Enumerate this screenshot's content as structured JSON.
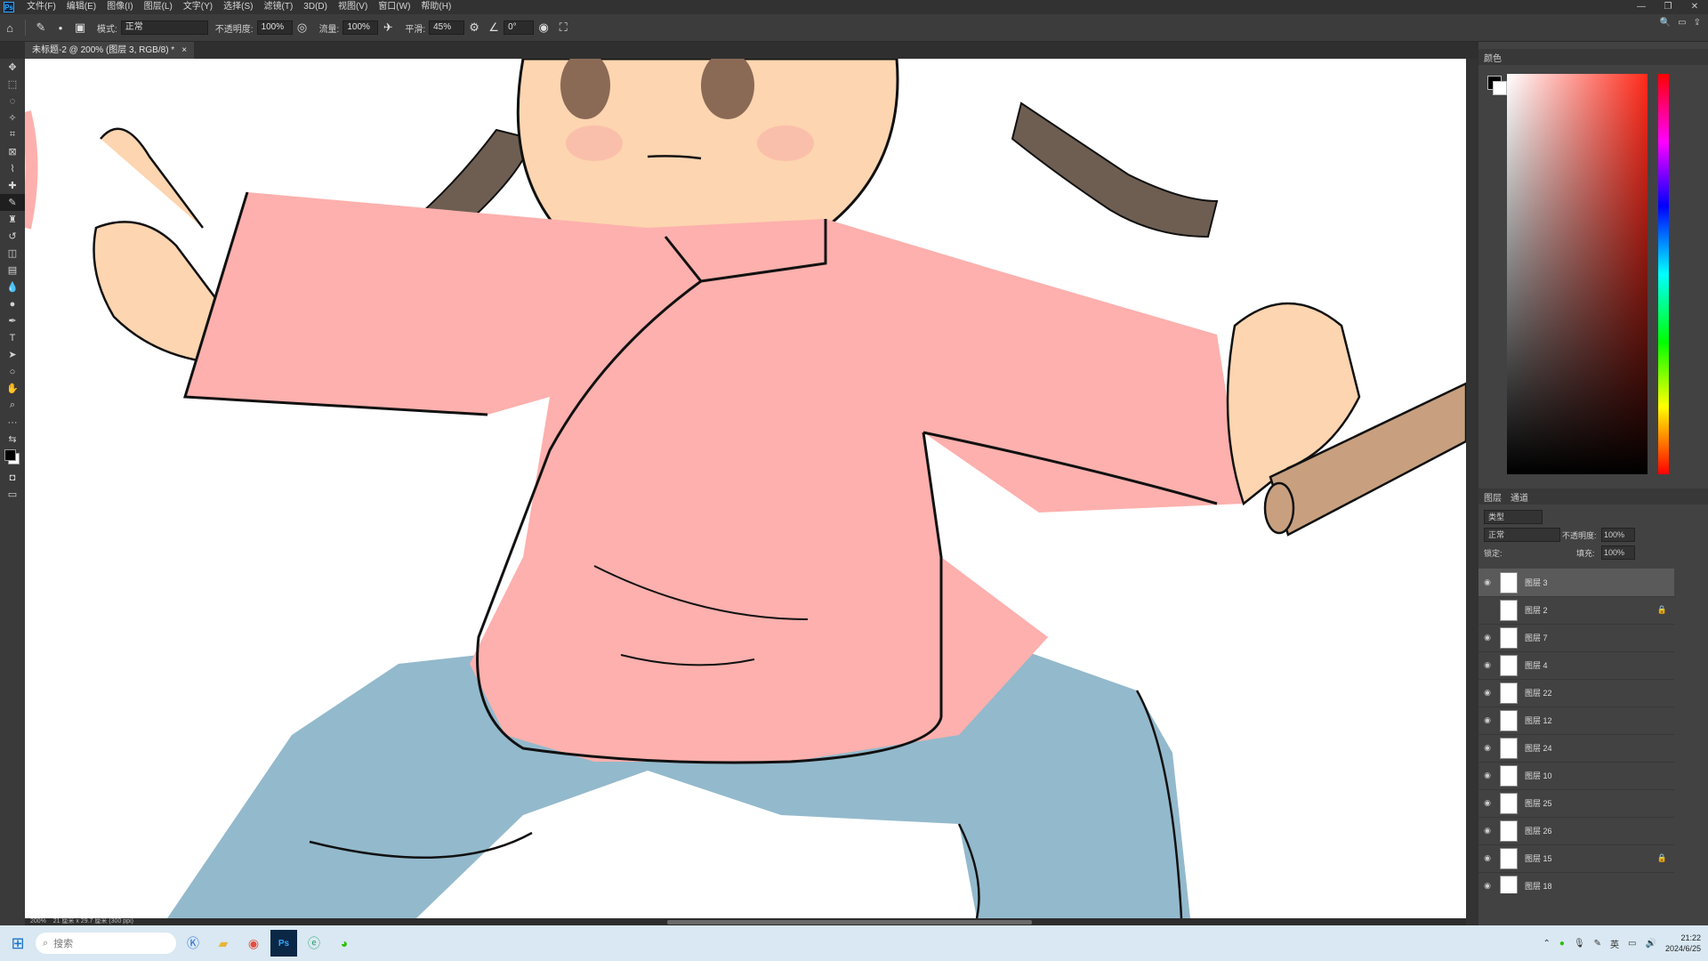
{
  "menu": {
    "app_logo": "Ps",
    "items": [
      "文件(F)",
      "编辑(E)",
      "图像(I)",
      "图层(L)",
      "文字(Y)",
      "选择(S)",
      "滤镜(T)",
      "3D(D)",
      "视图(V)",
      "窗口(W)",
      "帮助(H)"
    ]
  },
  "window_controls": [
    "—",
    "❐",
    "✕"
  ],
  "options": {
    "mode_label": "模式:",
    "mode_value": "正常",
    "opacity_label": "不透明度:",
    "opacity_value": "100%",
    "flow_label": "流量:",
    "flow_value": "100%",
    "smoothing_label": "平滑:",
    "smoothing_value": "45%",
    "angle_value": "0°"
  },
  "document": {
    "tab_title": "未标题-2 @ 200% (图层 3, RGB/8) *",
    "tab_close": "×"
  },
  "status": {
    "zoom": "200%",
    "doc_size": "21 厘米 x 29.7 厘米 (300 ppi)"
  },
  "color_panel": {
    "tab": "颜色",
    "foreground": "#000000",
    "background": "#ffffff"
  },
  "layers_panel": {
    "tabs": [
      "图层",
      "通道"
    ],
    "filter_label": "类型",
    "blend_mode": "正常",
    "opacity_label": "不透明度:",
    "opacity_value": "100%",
    "lock_label": "锁定:",
    "fill_label": "填充:",
    "fill_value": "100%",
    "layers": [
      {
        "name": "图层 3",
        "visible": true,
        "locked": false,
        "active": true
      },
      {
        "name": "图层 2",
        "visible": false,
        "locked": true,
        "active": false
      },
      {
        "name": "图层 7",
        "visible": true,
        "locked": false,
        "active": false
      },
      {
        "name": "图层 4",
        "visible": true,
        "locked": false,
        "active": false
      },
      {
        "name": "图层 22",
        "visible": true,
        "locked": false,
        "active": false
      },
      {
        "name": "图层 12",
        "visible": true,
        "locked": false,
        "active": false
      },
      {
        "name": "图层 24",
        "visible": true,
        "locked": false,
        "active": false
      },
      {
        "name": "图层 10",
        "visible": true,
        "locked": false,
        "active": false
      },
      {
        "name": "图层 25",
        "visible": true,
        "locked": false,
        "active": false
      },
      {
        "name": "图层 26",
        "visible": true,
        "locked": false,
        "active": false
      },
      {
        "name": "图层 15",
        "visible": true,
        "locked": true,
        "active": false
      },
      {
        "name": "图层 18",
        "visible": true,
        "locked": false,
        "active": false
      }
    ]
  },
  "taskbar": {
    "search_placeholder": "搜索",
    "ime": "英",
    "time": "21:22",
    "date": "2024/6/25"
  },
  "colors": {
    "shirt": "#fdb0ad",
    "pants": "#93b9cc",
    "skin": "#fdd5b0",
    "hair": "#6e5e52",
    "stick": "#c8a07f"
  }
}
